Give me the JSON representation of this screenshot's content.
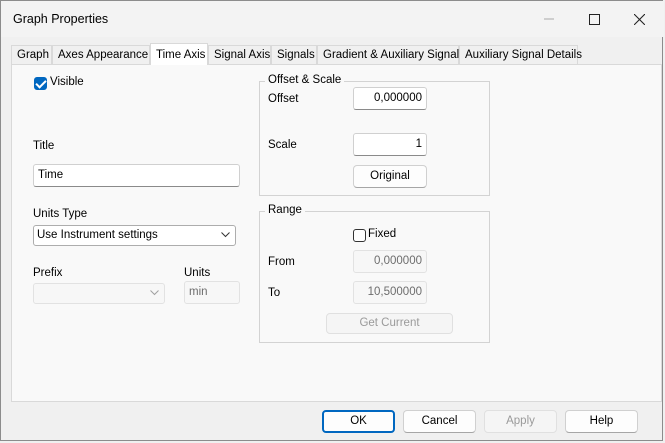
{
  "window": {
    "title": "Graph Properties"
  },
  "tabs": [
    {
      "label": "Graph",
      "active": false
    },
    {
      "label": "Axes Appearance",
      "active": false
    },
    {
      "label": "Time Axis",
      "active": true
    },
    {
      "label": "Signal Axis",
      "active": false
    },
    {
      "label": "Signals",
      "active": false
    },
    {
      "label": "Gradient & Auxiliary Signals",
      "active": false
    },
    {
      "label": "Auxiliary Signal Details",
      "active": false
    }
  ],
  "left": {
    "visible_label": "Visible",
    "visible_checked": true,
    "title_label": "Title",
    "title_value": "Time",
    "units_type_label": "Units Type",
    "units_type_value": "Use Instrument settings",
    "prefix_label": "Prefix",
    "prefix_value": "",
    "units_label": "Units",
    "units_value": "min"
  },
  "offset_scale": {
    "group_title": "Offset & Scale",
    "offset_label": "Offset",
    "offset_value": "0,000000",
    "scale_label": "Scale",
    "scale_value": "1",
    "original_button": "Original"
  },
  "range": {
    "group_title": "Range",
    "fixed_label": "Fixed",
    "fixed_checked": false,
    "from_label": "From",
    "from_value": "0,000000",
    "to_label": "To",
    "to_value": "10,500000",
    "get_current_button": "Get Current"
  },
  "footer": {
    "ok": "OK",
    "cancel": "Cancel",
    "apply": "Apply",
    "help": "Help"
  },
  "colors": {
    "accent": "#0067c0",
    "window_bg": "#f0f0f0",
    "panel_bg": "#f9f9f9"
  }
}
